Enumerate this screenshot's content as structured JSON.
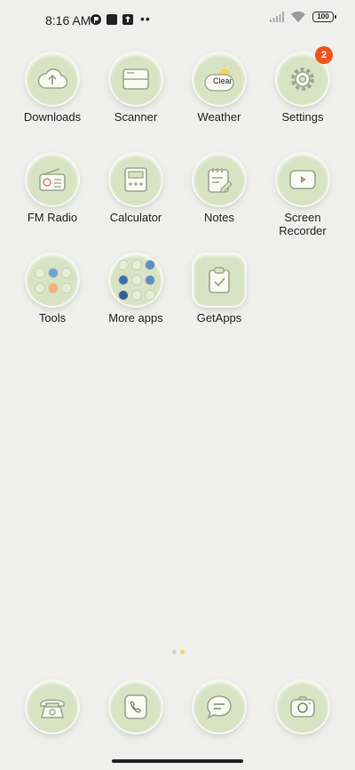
{
  "status": {
    "time": "8:16 AM",
    "battery": "100"
  },
  "apps": [
    {
      "label": "Downloads"
    },
    {
      "label": "Scanner"
    },
    {
      "label": "Weather",
      "widget_text": "Clear"
    },
    {
      "label": "Settings",
      "badge": "2"
    },
    {
      "label": "FM Radio"
    },
    {
      "label": "Calculator"
    },
    {
      "label": "Notes"
    },
    {
      "label": "Screen\nRecorder"
    },
    {
      "label": "Tools"
    },
    {
      "label": "More apps"
    },
    {
      "label": "GetApps"
    }
  ],
  "dock": [
    {
      "name": "phone-icon"
    },
    {
      "name": "contacts-icon"
    },
    {
      "name": "messages-icon"
    },
    {
      "name": "camera-icon"
    }
  ],
  "colors": {
    "background": "#efefed",
    "icon_fill": "#d8e3c4",
    "badge": "#f3531c"
  }
}
